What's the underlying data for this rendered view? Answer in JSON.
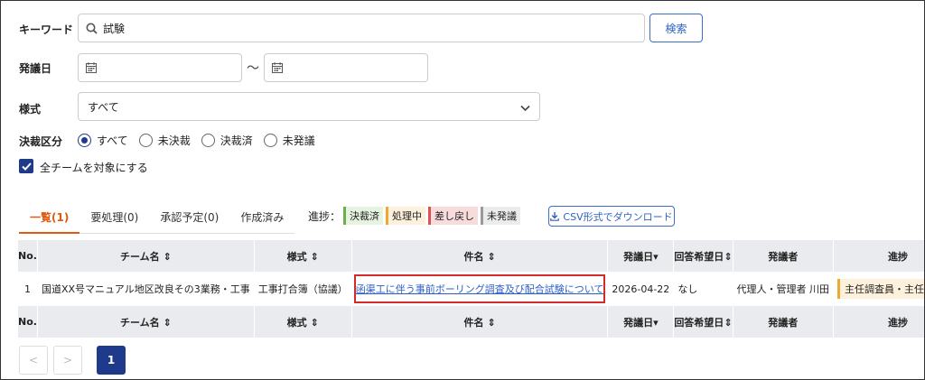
{
  "search": {
    "keyword_label": "キーワード",
    "keyword_value": "試験",
    "search_button": "検索",
    "date_label": "発議日",
    "date_separator": "〜",
    "style_label": "様式",
    "style_value": "すべて",
    "decision_label": "決裁区分",
    "decision_options": [
      "すべて",
      "未決裁",
      "決裁済",
      "未発議"
    ],
    "decision_selected": "すべて",
    "all_teams_label": "全チームを対象にする",
    "all_teams_checked": true
  },
  "tabs": [
    "一覧(1)",
    "要処理(0)",
    "承認予定(0)",
    "作成済み"
  ],
  "progress": {
    "label": "進捗：",
    "chips": [
      {
        "label": "決裁済",
        "bg": "#e7f3e1",
        "border": "#6ab04c"
      },
      {
        "label": "処理中",
        "bg": "#fdf1dc",
        "border": "#f0a830"
      },
      {
        "label": "差し戻し",
        "bg": "#f8dcdc",
        "border": "#e05252"
      },
      {
        "label": "未発議",
        "bg": "#ececec",
        "border": "#999999"
      }
    ]
  },
  "csv_button": "CSV形式でダウンロード",
  "table": {
    "headers": [
      "No.",
      "チーム名",
      "様式",
      "件名",
      "発議日",
      "回答希望日",
      "発議者",
      "進捗"
    ],
    "row": {
      "no": "1",
      "team": "国道XX号マニュアル地区改良その3業務・工事",
      "style": "工事打合簿（協議）",
      "subject": "函渠工に伴う事前ボーリング調査及び配合試験について",
      "date": "2026-04-22",
      "reply": "なし",
      "proposer": "代理人・管理者 川田",
      "progress": "主任調査員・主任監督員"
    }
  },
  "pagination": {
    "prev": "<",
    "next": ">",
    "current": "1"
  }
}
